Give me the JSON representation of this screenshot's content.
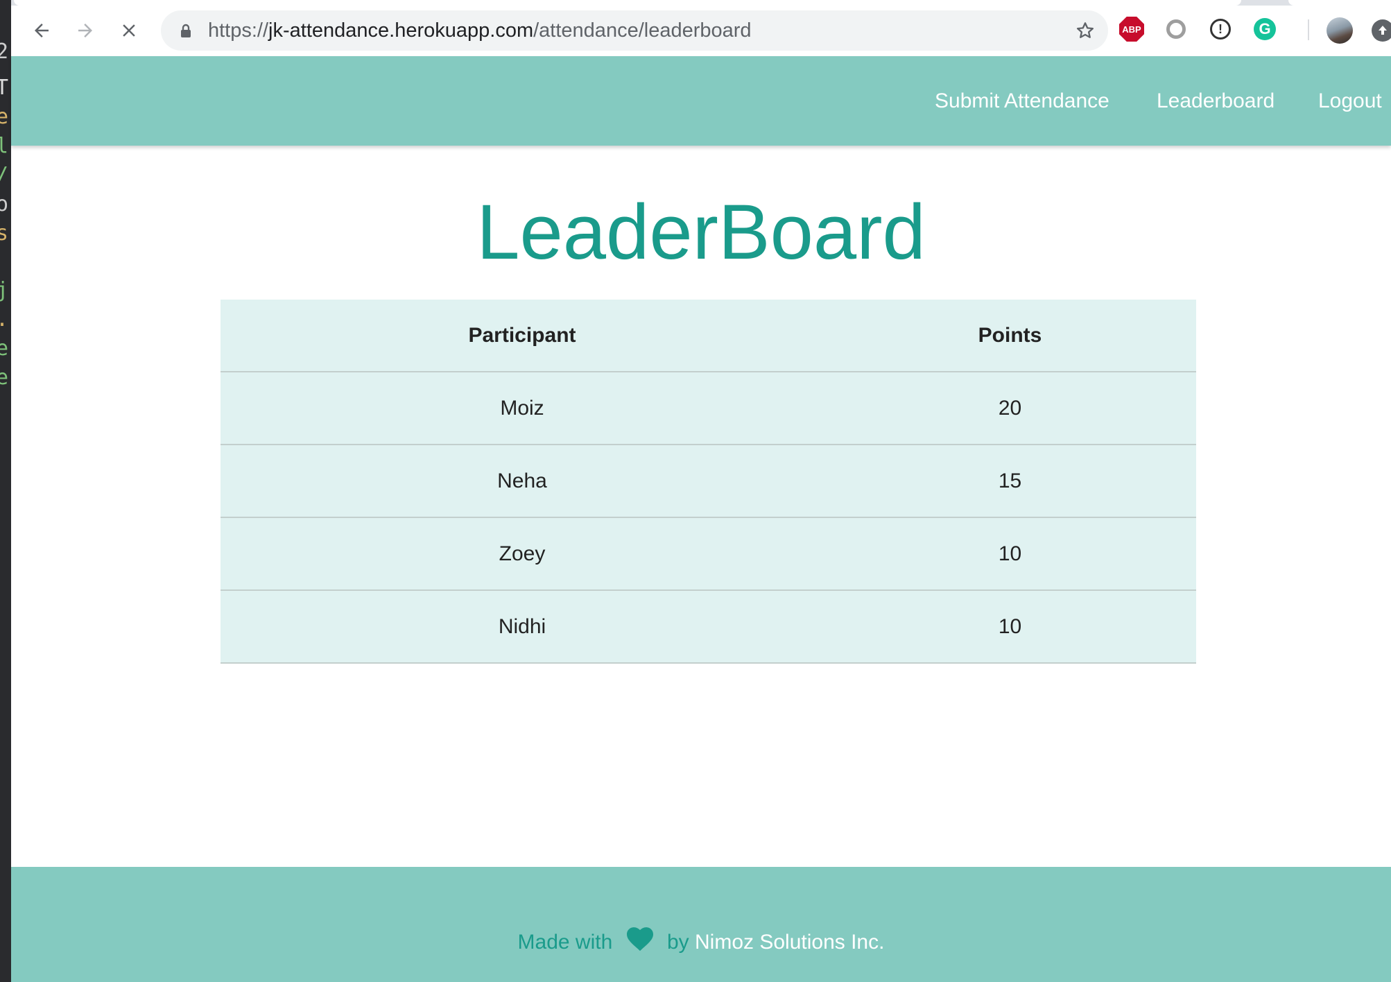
{
  "browser": {
    "url_scheme": "https://",
    "url_host": "jk-attendance.herokuapp.com",
    "url_path": "/attendance/leaderboard",
    "extensions": {
      "adblock_label": "ABP",
      "grammarly_label": "G"
    }
  },
  "navbar": {
    "links": [
      {
        "label": "Submit Attendance"
      },
      {
        "label": "Leaderboard"
      },
      {
        "label": "Logout"
      }
    ]
  },
  "main": {
    "title": "LeaderBoard",
    "table": {
      "headers": [
        "Participant",
        "Points"
      ],
      "rows": [
        {
          "participant": "Moiz",
          "points": "20"
        },
        {
          "participant": "Neha",
          "points": "15"
        },
        {
          "participant": "Zoey",
          "points": "10"
        },
        {
          "participant": "Nidhi",
          "points": "10"
        }
      ]
    }
  },
  "footer": {
    "prefix": "Made with",
    "middle": "by",
    "company": "Nimoz Solutions Inc."
  },
  "colors": {
    "brand": "#84cac0",
    "accent": "#1a9b8b",
    "table_bg": "#e0f2f1"
  },
  "icons": [
    "back-arrow-icon",
    "forward-arrow-icon",
    "stop-loading-icon",
    "lock-icon",
    "star-icon",
    "heart-icon",
    "update-icon"
  ]
}
